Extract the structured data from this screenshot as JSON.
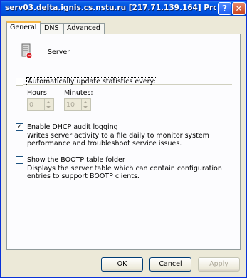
{
  "window": {
    "title": "serv03.delta.ignis.cs.nstu.ru [217.71.139.164] Pro...",
    "help_glyph": "?",
    "close_glyph": "✕"
  },
  "tabs": [
    {
      "label": "General",
      "active": true
    },
    {
      "label": "DNS",
      "active": false
    },
    {
      "label": "Advanced",
      "active": false
    }
  ],
  "header": {
    "icon": "server-icon",
    "label": "Server"
  },
  "auto_update": {
    "label": "Automatically update statistics every:",
    "checked": false,
    "hours_label": "Hours:",
    "minutes_label": "Minutes:",
    "hours_value": "0",
    "minutes_value": "10"
  },
  "dhcp_audit": {
    "label": "Enable DHCP audit logging",
    "checked": true,
    "description": "Writes server activity to a file daily to monitor system performance and troubleshoot service issues."
  },
  "bootp": {
    "label": "Show the BOOTP table folder",
    "checked": false,
    "description": "Displays the server table which can contain configuration entries to support BOOTP clients."
  },
  "buttons": {
    "ok": "OK",
    "cancel": "Cancel",
    "apply": "Apply"
  },
  "colors": {
    "titlebar": "#0054e3",
    "dialog": "#ece9d8",
    "panel": "#fcfcfe",
    "tab_highlight": "#f7b848"
  }
}
